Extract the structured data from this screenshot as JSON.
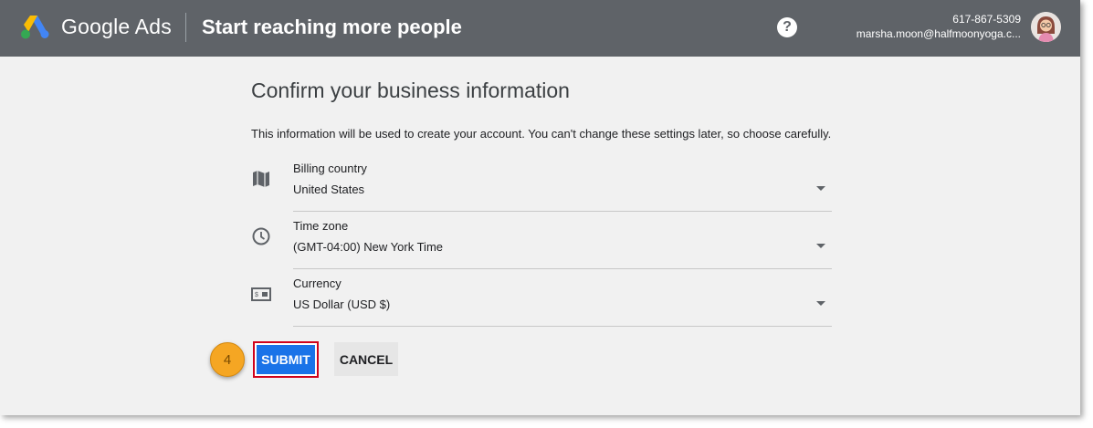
{
  "header": {
    "brand": "Google Ads",
    "title": "Start reaching more people",
    "help_icon": "help-circle-icon",
    "phone": "617-867-5309",
    "email": "marsha.moon@halfmoonyoga.c..."
  },
  "main": {
    "title": "Confirm your business information",
    "description": "This information will be used to create your account. You can't change these settings later, so choose carefully.",
    "fields": [
      {
        "label": "Billing country",
        "value": "United States",
        "icon": "map-icon"
      },
      {
        "label": "Time zone",
        "value": "(GMT-04:00) New York Time",
        "icon": "clock-icon"
      },
      {
        "label": "Currency",
        "value": "US Dollar (USD $)",
        "icon": "currency-card-icon"
      }
    ]
  },
  "actions": {
    "step_number": "4",
    "submit_label": "SUBMIT",
    "cancel_label": "CANCEL"
  },
  "colors": {
    "header_bg": "#5f6368",
    "primary": "#1a73e8",
    "highlight_border": "#d0021b",
    "step_badge": "#f5a623"
  }
}
